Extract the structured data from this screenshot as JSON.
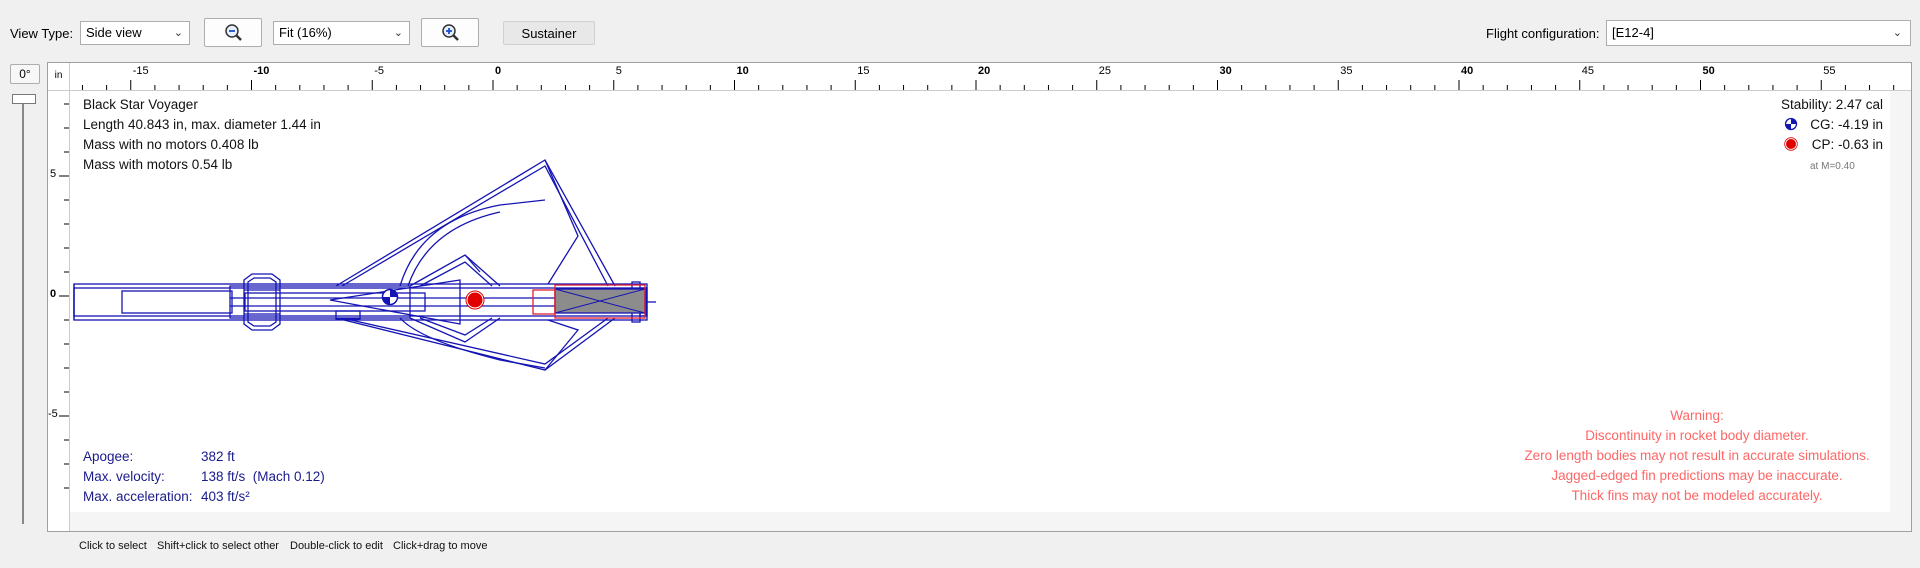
{
  "toolbar": {
    "view_type_label": "View Type:",
    "view_type_value": "Side view",
    "zoom_value": "Fit (16%)",
    "stage_button": "Sustainer",
    "flight_config_label": "Flight configuration:",
    "flight_config_value": "[E12-4]"
  },
  "rotation": {
    "angle": "0°"
  },
  "ruler": {
    "unit": "in",
    "h_labels": [
      "-15",
      "-10",
      "-5",
      "0",
      "5",
      "10",
      "15",
      "20",
      "25",
      "30",
      "35",
      "40",
      "45",
      "50",
      "55"
    ],
    "v_labels": [
      "5",
      "0",
      "-5"
    ]
  },
  "rocket": {
    "name": "Black Star Voyager",
    "length_line": "Length 40.843 in, max. diameter 1.44 in",
    "mass_no_motors": "Mass with no motors 0.408 lb",
    "mass_with_motors": "Mass with motors 0.54 lb"
  },
  "stability": {
    "value": "Stability: 2.47 cal",
    "cg": "CG: -4.19 in",
    "cp": "CP: -0.63 in",
    "mach": "at M=0.40"
  },
  "flight": {
    "apogee_label": "Apogee:",
    "apogee_value": "382 ft",
    "velocity_label": "Max. velocity:",
    "velocity_value": "138 ft/s  (Mach 0.12)",
    "accel_label": "Max. acceleration:",
    "accel_value": "403 ft/s²"
  },
  "warnings": {
    "title": "Warning:",
    "lines": [
      "Discontinuity in rocket body diameter.",
      "Zero length bodies may not result in accurate simulations.",
      "Jagged-edged fin predictions may be inaccurate.",
      "Thick fins may not be modeled accurately."
    ]
  },
  "hints": [
    "Click to select",
    "Shift+click to select other",
    "Double-click to edit",
    "Click+drag to move"
  ]
}
